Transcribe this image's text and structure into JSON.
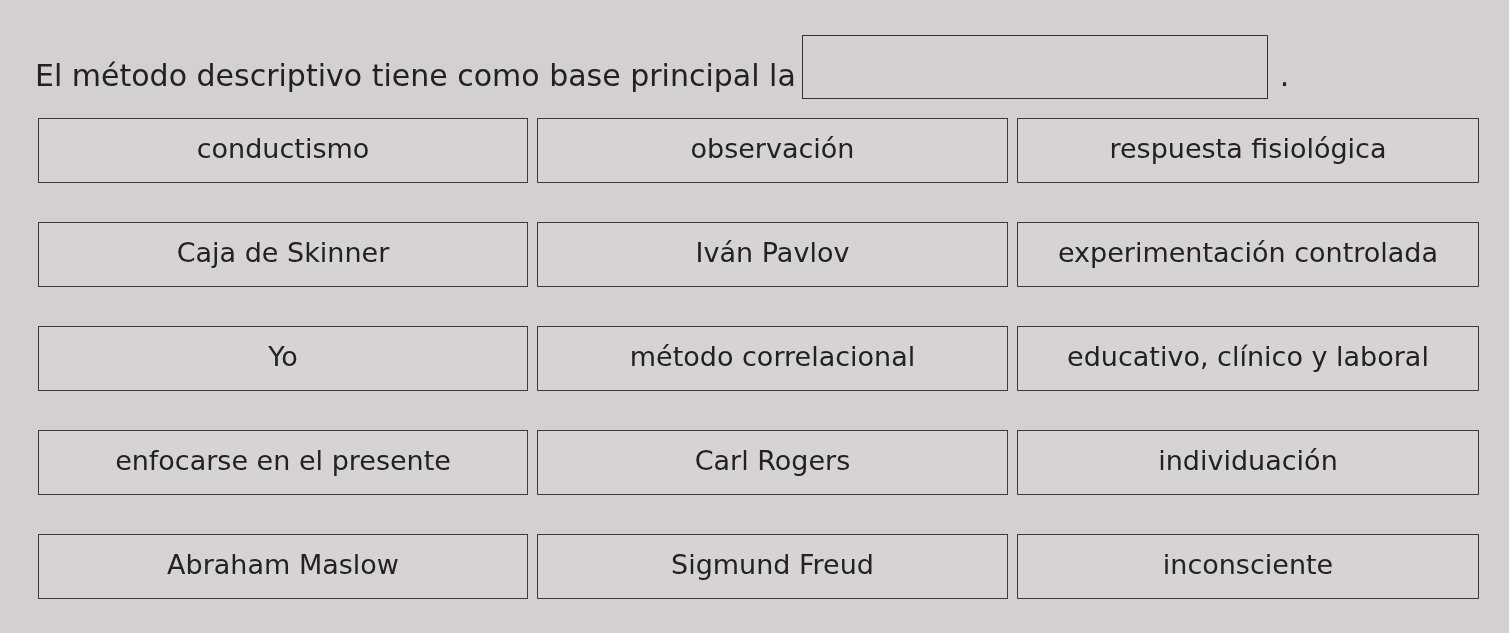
{
  "question": {
    "parts": [
      {
        "kind": "text",
        "text": "El método descriptivo tiene como base principal la"
      },
      {
        "kind": "blank"
      },
      {
        "kind": "text",
        "text": "."
      }
    ]
  },
  "options": [
    "conductismo",
    "observación",
    "respuesta fisiológica",
    "Caja de Skinner",
    "Iván Pavlov",
    "experimentación controlada",
    "Yo",
    "método correlacional",
    "educativo, clínico y laboral",
    "enfocarse en el presente",
    "Carl Rogers",
    "individuación",
    "Abraham Maslow",
    "Sigmund Freud",
    "inconsciente"
  ]
}
